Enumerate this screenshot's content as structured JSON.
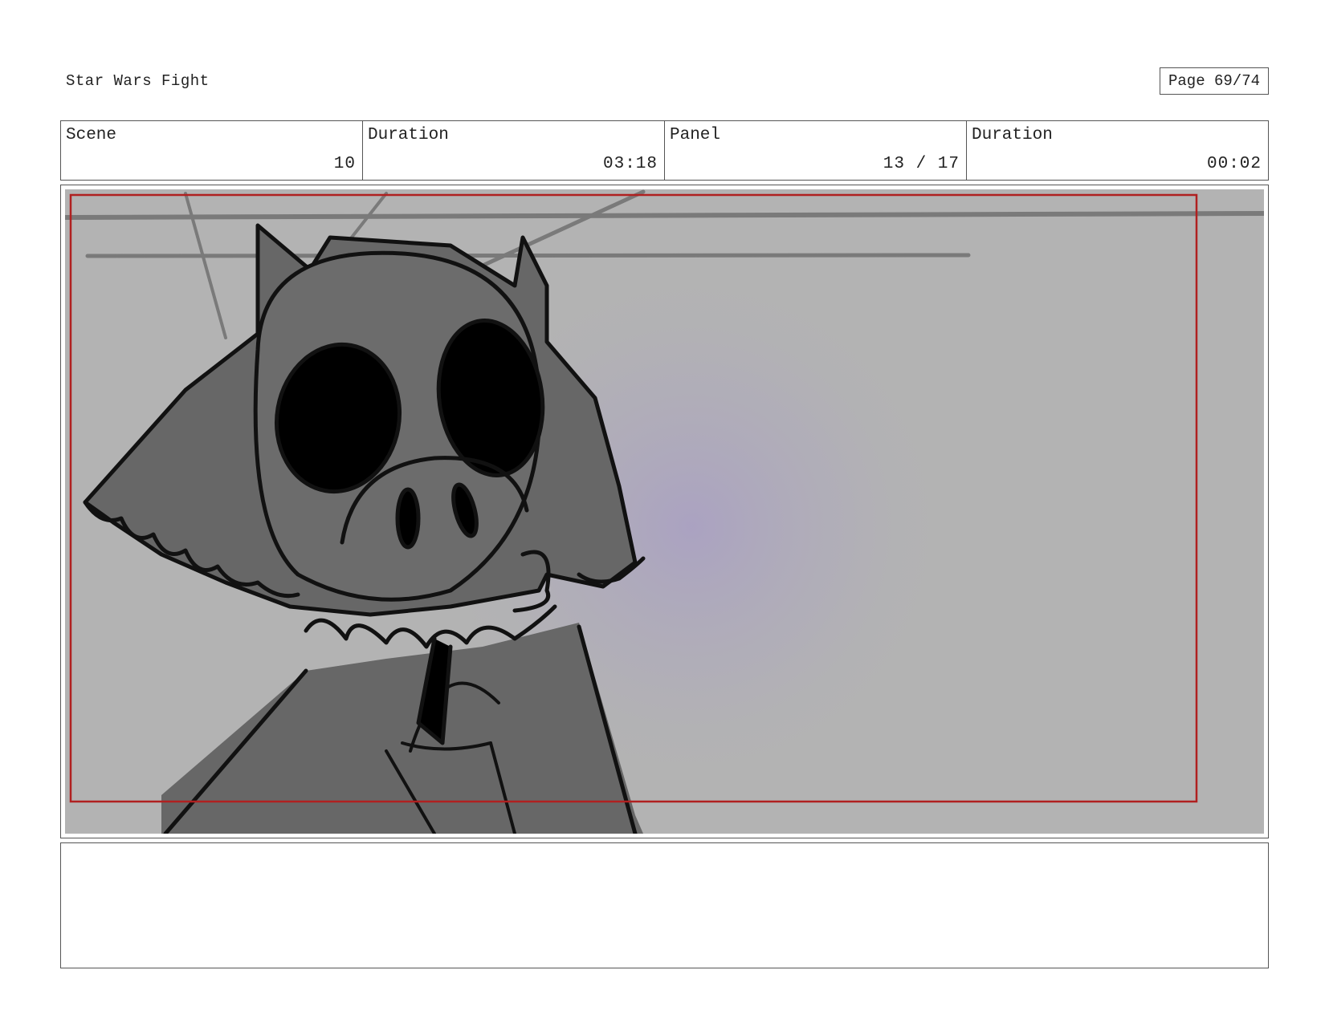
{
  "document": {
    "title": "Star Wars Fight",
    "page": "Page 69/74"
  },
  "header": {
    "scene_label": "Scene",
    "scene_value": "10",
    "duration_label": "Duration",
    "duration_value": "03:18",
    "panel_label": "Panel",
    "panel_value": "13 / 17",
    "panel_duration_label": "Duration",
    "panel_duration_value": "00:02"
  },
  "colors": {
    "frame_border": "#b02020",
    "background": "#b3b3b3",
    "character_fill": "#676767",
    "glow": "#a99fc4"
  }
}
